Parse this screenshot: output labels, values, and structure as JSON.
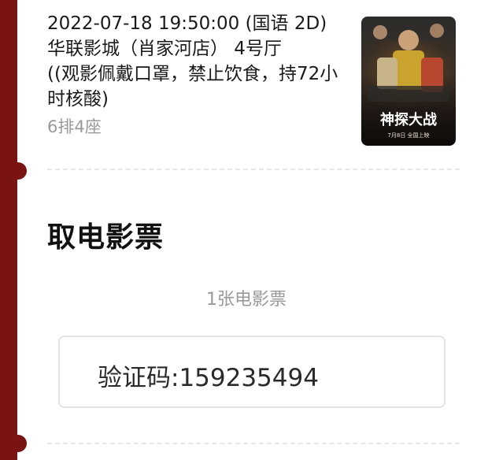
{
  "ticket": {
    "showtime": "2022-07-18 19:50:00 (国语 2D)",
    "venue": "华联影城（肖家河店） 4号厅",
    "notice": "((观影佩戴口罩，禁止饮食，持72小时核酸)",
    "seat": "6排4座",
    "poster": {
      "title_art": "神探大战",
      "release_line": "7月8日 全国上映"
    }
  },
  "pickup": {
    "title": "取电影票",
    "count": "1张电影票",
    "code_label": "验证码:159235494"
  },
  "colors": {
    "strip": "#7a1413",
    "title": "#111111",
    "muted": "#999999",
    "border": "#e3e3e3"
  }
}
